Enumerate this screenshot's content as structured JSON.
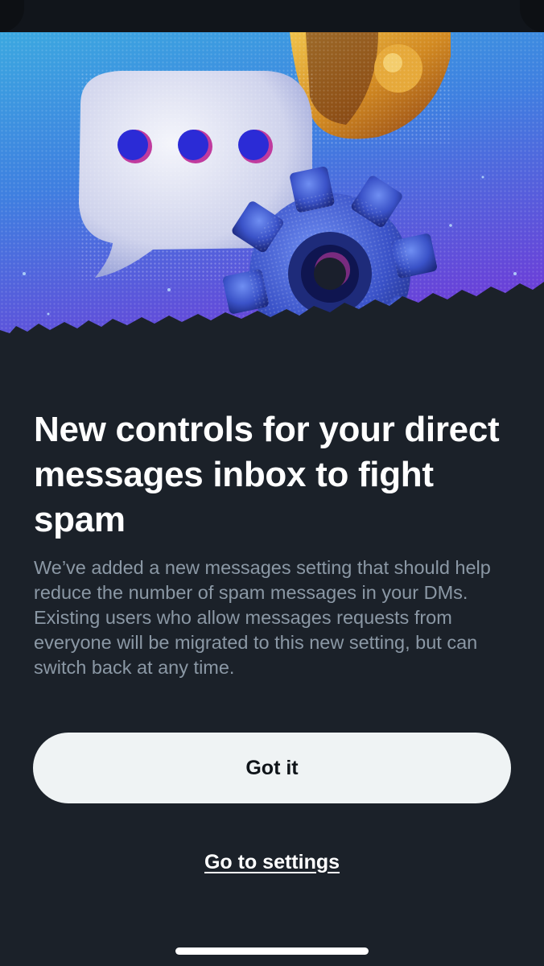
{
  "illustration": {
    "icons": [
      "chat-bubble-icon",
      "bell-icon",
      "gear-icon"
    ],
    "colors": {
      "sky_top": "#3ba8e0",
      "sky_bottom": "#6b3fd8",
      "bubble": "#dcdff0",
      "dots": "#2b2bd6",
      "gear": "#3a52c8",
      "bell": "#d79a2a"
    }
  },
  "dialog": {
    "title": "New controls for your direct messages inbox to fight spam",
    "body": "We’ve added a new messages setting that should help reduce the number of spam messages in your DMs. Existing users who allow messages requests from everyone will be migrated to this new setting, but can switch back at any time.",
    "primary_button": "Got it",
    "secondary_link": "Go to settings"
  },
  "colors": {
    "background": "#1b2129",
    "title": "#ffffff",
    "body": "#8b98a5",
    "button_bg": "#eff3f4",
    "button_text": "#0f1419"
  }
}
